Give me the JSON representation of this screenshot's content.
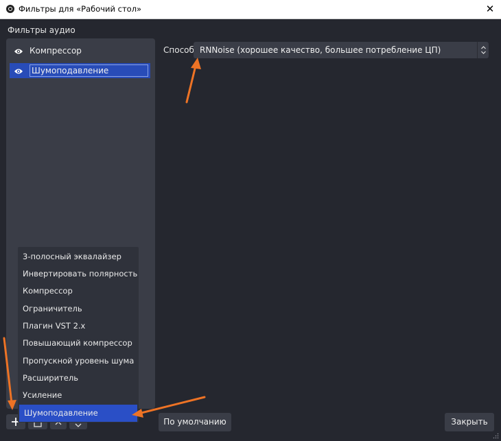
{
  "window": {
    "title": "Фильтры для «Рабочий стол»",
    "close_glyph": "✕"
  },
  "filters_section": {
    "label": "Фильтры аудио",
    "items": [
      {
        "label": "Компрессор",
        "icon": "eye-icon",
        "selected": false
      },
      {
        "label": "Шумоподавление",
        "icon": "eye-icon",
        "selected": true
      }
    ]
  },
  "settings": {
    "method_label": "Способ",
    "method_value": "RNNoise (хорошее качество, большее потребление ЦП)"
  },
  "add_menu": {
    "items": [
      "3-полосный эквалайзер",
      "Инвертировать полярность",
      "Компрессор",
      "Ограничитель",
      "Плагин VST 2.x",
      "Повышающий компрессор",
      "Пропускной уровень шума",
      "Расширитель",
      "Усиление",
      "Шумоподавление"
    ],
    "active_item": "Шумоподавление"
  },
  "buttons": {
    "defaults": "По умолчанию",
    "close": "Закрыть",
    "add_glyph": "+"
  },
  "colors": {
    "background": "#25272f",
    "panel": "#3a3d47",
    "selection": "#284cb8",
    "annotation_arrow": "#ee7325"
  }
}
